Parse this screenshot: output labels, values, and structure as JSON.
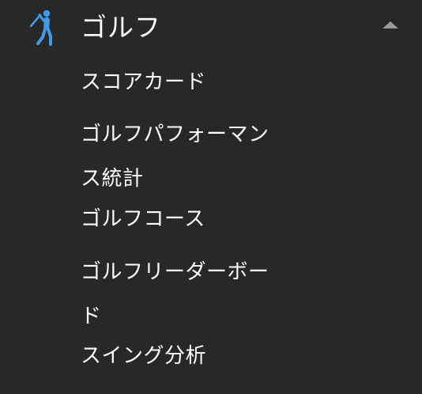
{
  "section": {
    "title": "ゴルフ",
    "icon": "golfer-icon",
    "expanded_icon": "chevron-up-icon",
    "accent_color": "#3d9be9"
  },
  "items": [
    {
      "label": "スコアカード"
    },
    {
      "label": "ゴルフパフォーマンス統計"
    },
    {
      "label": "ゴルフコース"
    },
    {
      "label": "ゴルフリーダーボード"
    },
    {
      "label": "スイング分析"
    }
  ]
}
